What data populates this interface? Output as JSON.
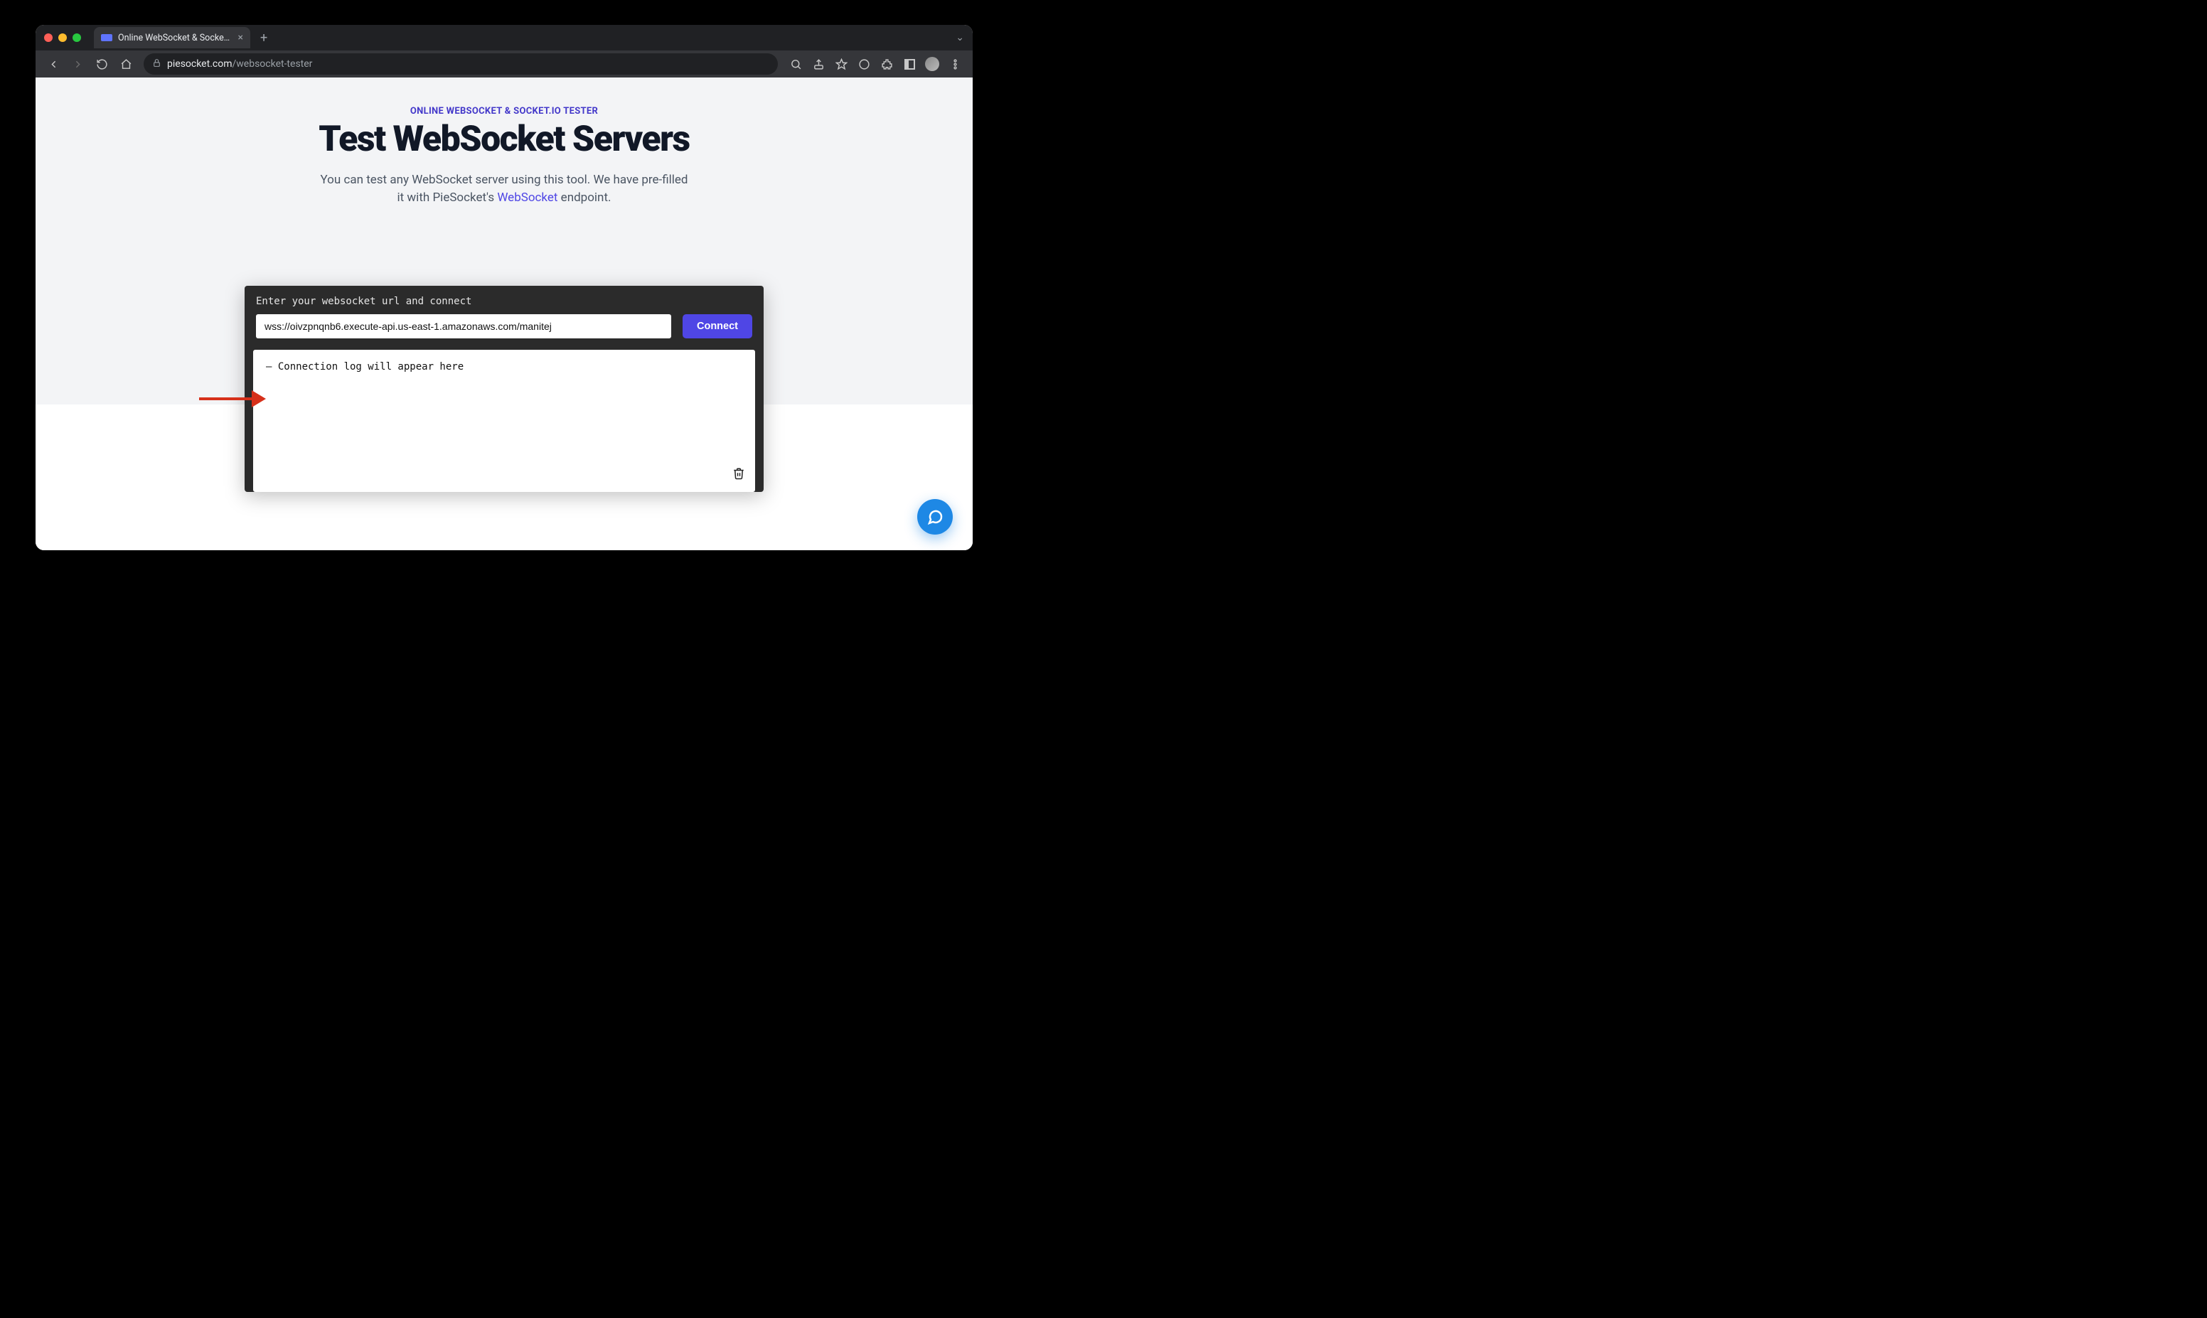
{
  "browser": {
    "tab_title": "Online WebSocket & Socket.io",
    "url_host": "piesocket.com",
    "url_path": "/websocket-tester"
  },
  "hero": {
    "eyebrow": "ONLINE WEBSOCKET & SOCKET.IO TESTER",
    "headline": "Test WebSocket Servers",
    "sub_before": "You can test any WebSocket server using this tool. We have pre-filled it with PieSocket's ",
    "sub_link": "WebSocket",
    "sub_after": " endpoint."
  },
  "tester": {
    "prompt": "Enter your websocket url and connect",
    "url_value": "wss://oivzpnqnb6.execute-api.us-east-1.amazonaws.com/manitej",
    "connect_label": "Connect",
    "log_placeholder": "Connection log will appear here"
  }
}
